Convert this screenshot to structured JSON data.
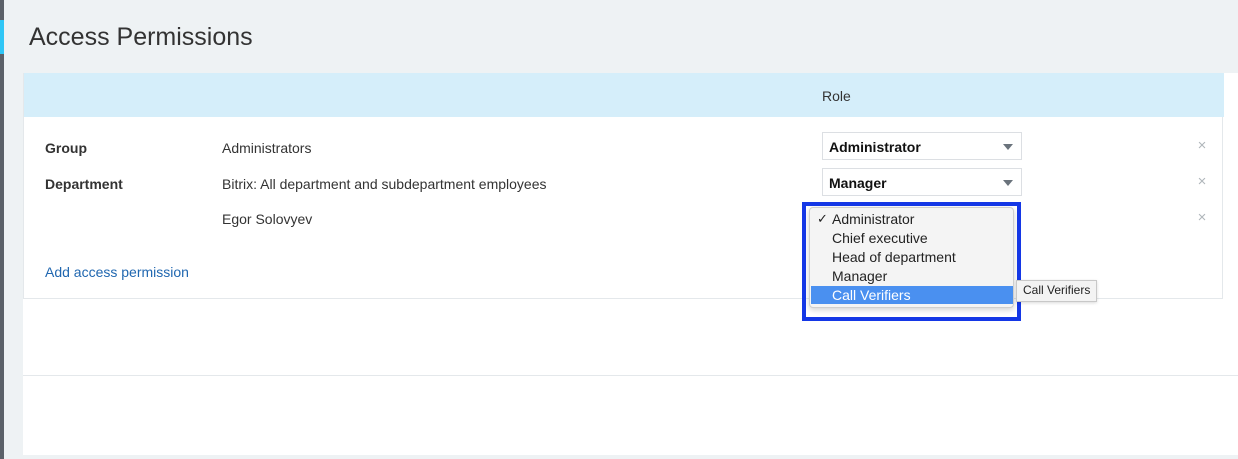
{
  "header": {
    "title": "Access Permissions"
  },
  "table": {
    "role_header": "Role",
    "rows": [
      {
        "type": "Group",
        "name": "Administrators",
        "role": "Administrator"
      },
      {
        "type": "Department",
        "name": "Bitrix: All department and subdepartment employees",
        "role": "Manager"
      },
      {
        "type": "",
        "name": "Egor Solovyev",
        "role": ""
      }
    ]
  },
  "add_link": "Add access permission",
  "dropdown": {
    "checked": "Administrator",
    "highlighted": "Call Verifiers",
    "options": [
      "Administrator",
      "Chief executive",
      "Head of department",
      "Manager",
      "Call Verifiers"
    ]
  },
  "tooltip": "Call Verifiers",
  "icons": {
    "remove": "close-icon",
    "check": "check-icon",
    "arrow": "chevron-down-icon"
  },
  "colors": {
    "header_bg": "#d5eefa",
    "link": "#2067b0",
    "highlight": "#4a90f0",
    "annotation_border": "#1437e6"
  }
}
